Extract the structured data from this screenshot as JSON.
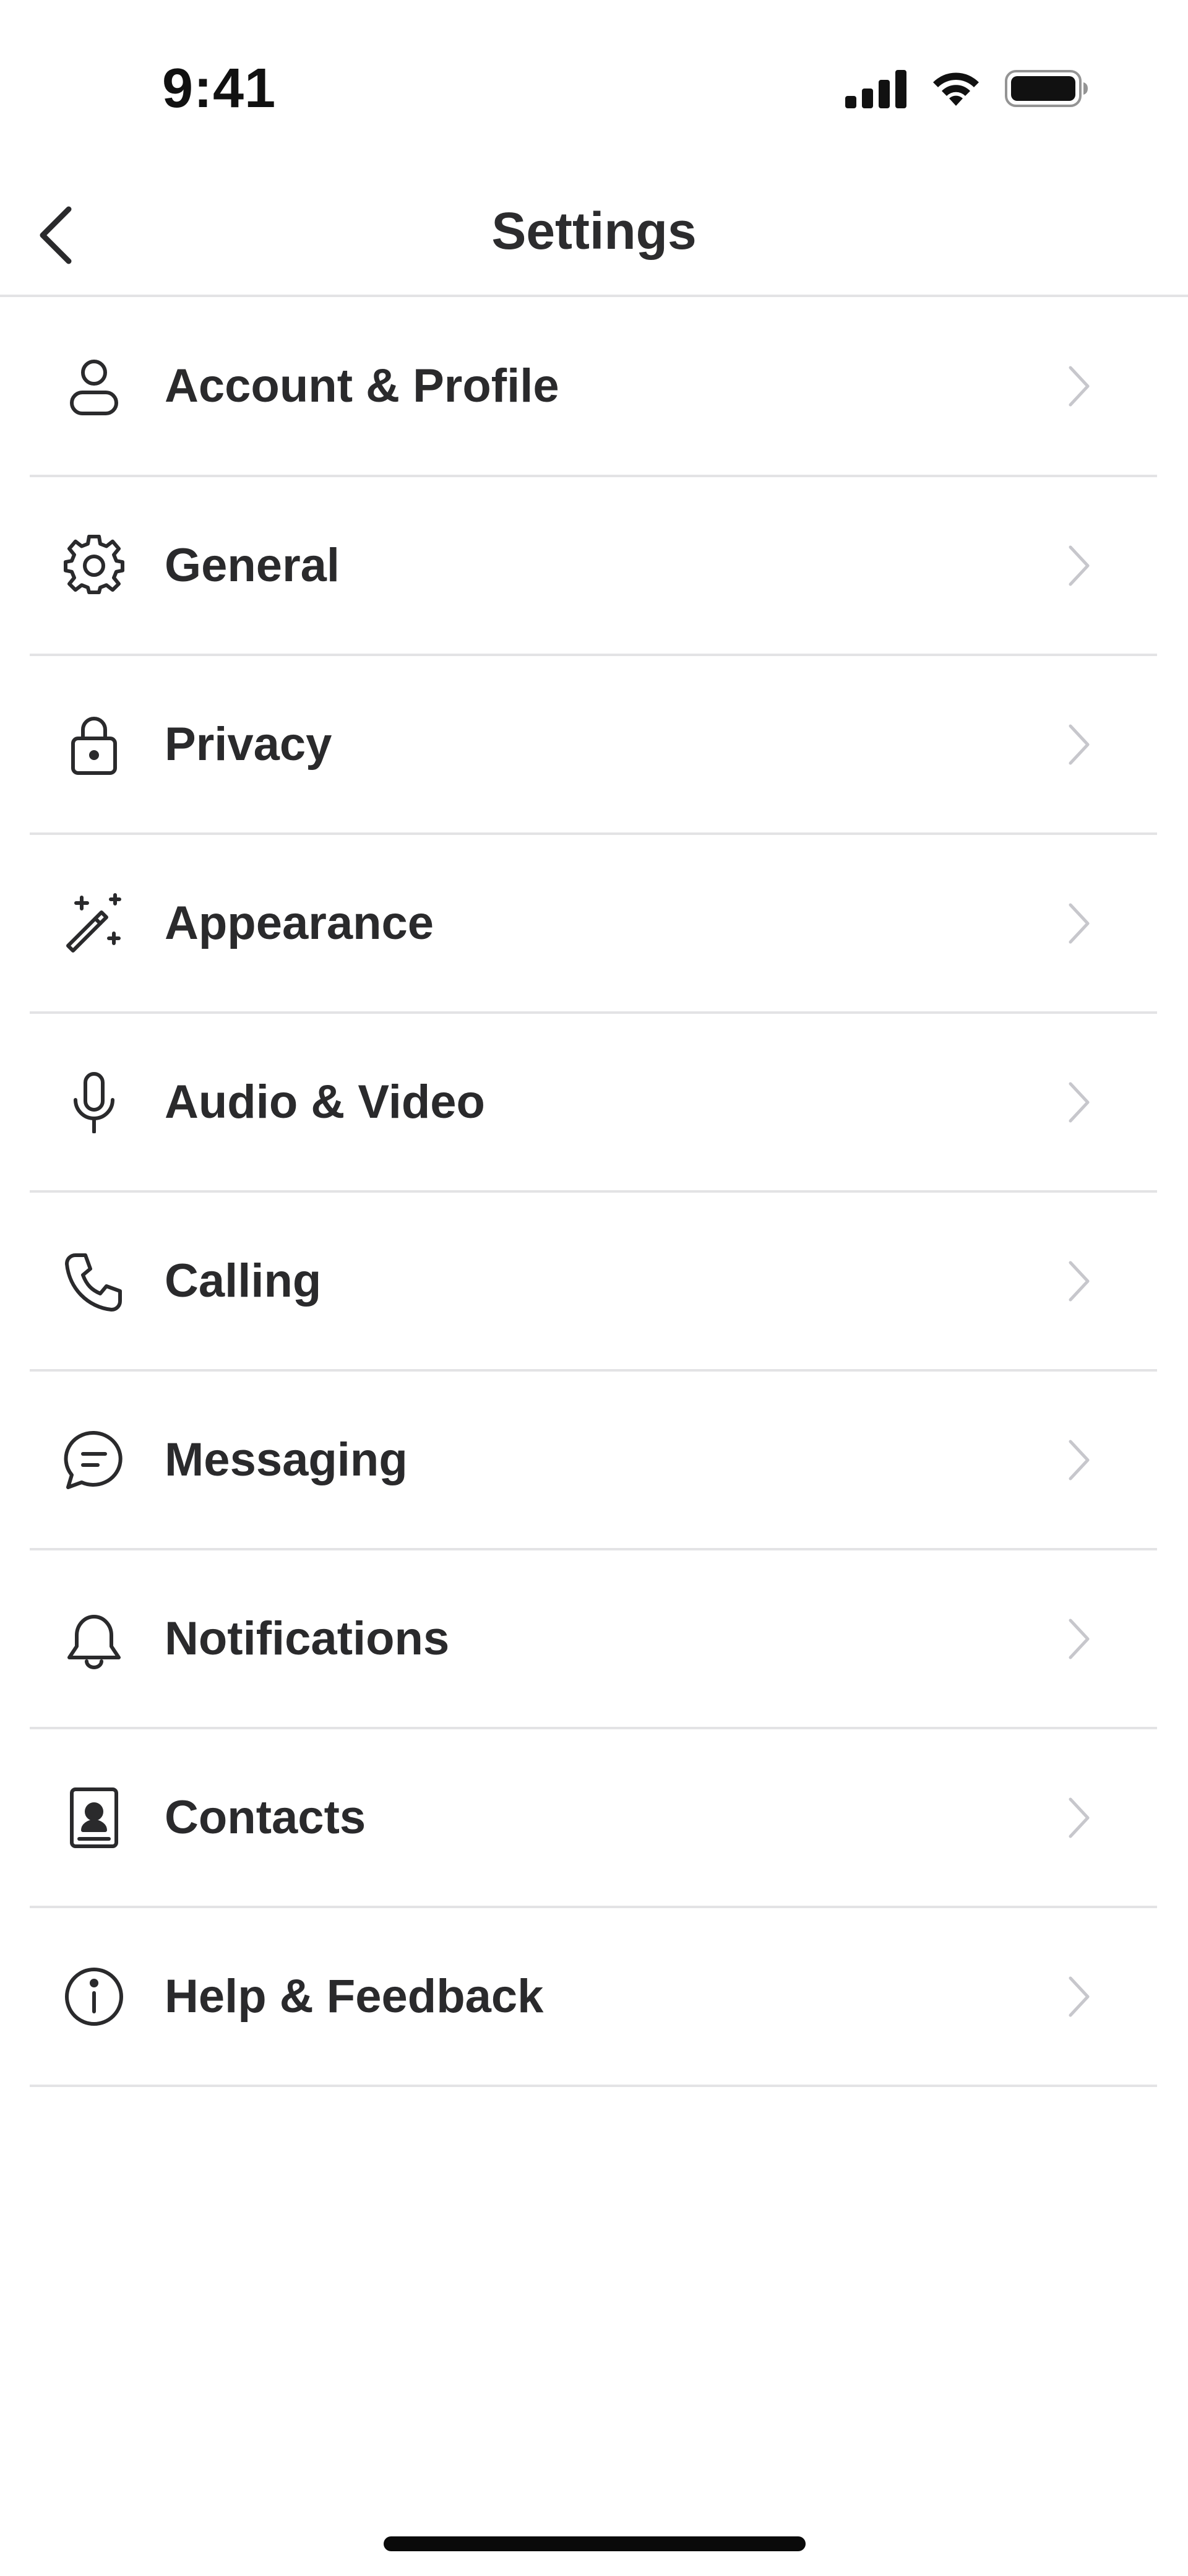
{
  "status_bar": {
    "time": "9:41"
  },
  "nav": {
    "title": "Settings"
  },
  "settings": {
    "items": [
      {
        "label": "Account & Profile",
        "icon": "person-icon"
      },
      {
        "label": "General",
        "icon": "gear-icon"
      },
      {
        "label": "Privacy",
        "icon": "lock-icon"
      },
      {
        "label": "Appearance",
        "icon": "magic-wand-icon"
      },
      {
        "label": "Audio & Video",
        "icon": "microphone-icon"
      },
      {
        "label": "Calling",
        "icon": "phone-icon"
      },
      {
        "label": "Messaging",
        "icon": "chat-bubble-icon"
      },
      {
        "label": "Notifications",
        "icon": "bell-icon"
      },
      {
        "label": "Contacts",
        "icon": "contact-book-icon"
      },
      {
        "label": "Help & Feedback",
        "icon": "info-icon"
      }
    ]
  },
  "colors": {
    "text": "#2a2a2c",
    "separator": "#e3e3e5",
    "chevron": "#c7c7cc",
    "background": "#ffffff"
  }
}
